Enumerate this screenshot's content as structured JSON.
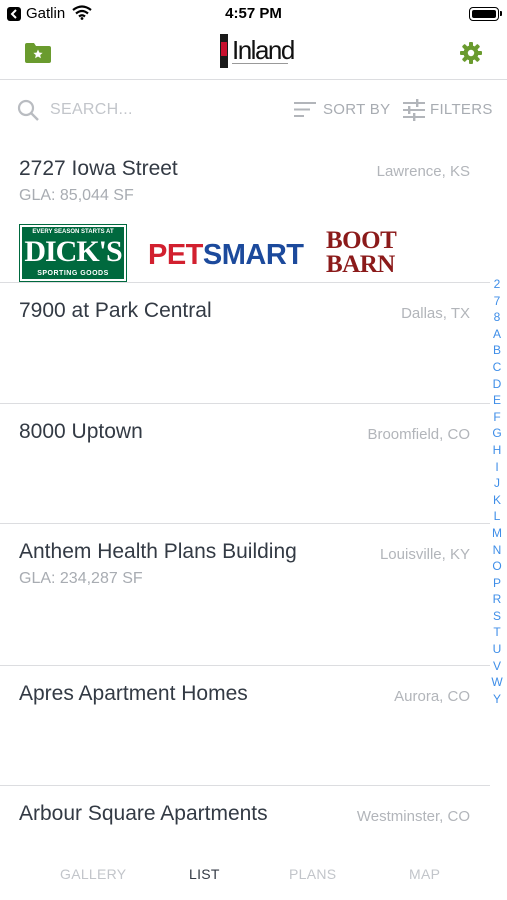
{
  "status_bar": {
    "carrier": "Gatlin",
    "time": "4:57 PM"
  },
  "nav": {
    "logo_text": "Inland",
    "accent_color": "#6a9b2e"
  },
  "search": {
    "placeholder": "SEARCH...",
    "sort_label": "SORT BY",
    "filters_label": "FILTERS"
  },
  "properties": [
    {
      "name": "2727 Iowa Street",
      "location": "Lawrence, KS",
      "gla": "GLA: 85,044 SF",
      "tenants": {
        "dicks_top": "EVERY SEASON STARTS AT",
        "dicks": "DICK'S",
        "dicks_bottom": "SPORTING GOODS",
        "petsmart_pet": "PET",
        "petsmart_smart": "SMART",
        "bootbarn": "BOOT BARN"
      }
    },
    {
      "name": "7900 at Park Central",
      "location": "Dallas, TX",
      "gla": ""
    },
    {
      "name": "8000 Uptown",
      "location": "Broomfield, CO",
      "gla": ""
    },
    {
      "name": "Anthem Health Plans Building",
      "location": "Louisville, KY",
      "gla": "GLA: 234,287 SF"
    },
    {
      "name": "Apres Apartment Homes",
      "location": "Aurora, CO",
      "gla": ""
    },
    {
      "name": "Arbour Square Apartments",
      "location": "Westminster, CO",
      "gla": ""
    }
  ],
  "index_letters": [
    "2",
    "7",
    "8",
    "A",
    "B",
    "C",
    "D",
    "E",
    "F",
    "G",
    "H",
    "I",
    "J",
    "K",
    "L",
    "M",
    "N",
    "O",
    "P",
    "R",
    "S",
    "T",
    "U",
    "V",
    "W",
    "Y"
  ],
  "tabs": [
    {
      "label": "GALLERY",
      "active": false
    },
    {
      "label": "LIST",
      "active": true
    },
    {
      "label": "PLANS",
      "active": false
    },
    {
      "label": "MAP",
      "active": false
    }
  ]
}
